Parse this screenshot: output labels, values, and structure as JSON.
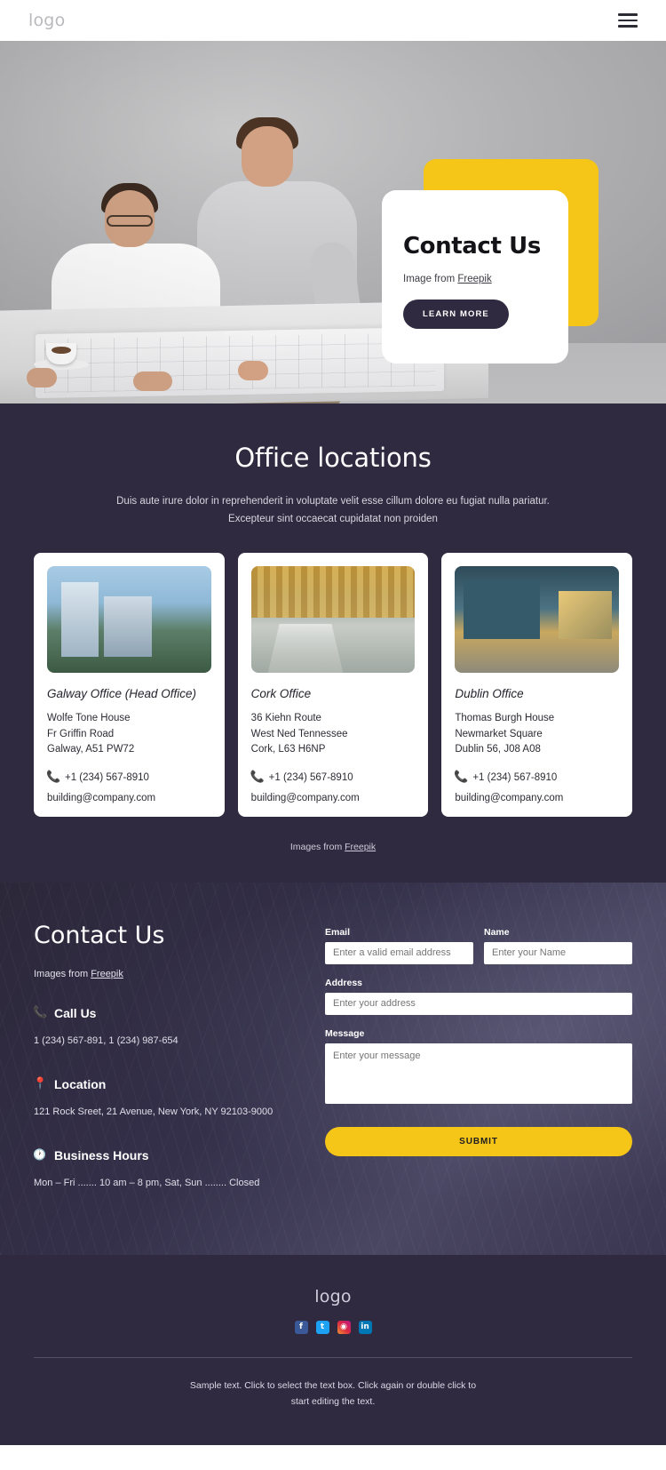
{
  "header": {
    "logo": "logo",
    "menu_icon": "hamburger-menu-icon"
  },
  "hero": {
    "title": "Contact Us",
    "credit_prefix": "Image from ",
    "credit_link": "Freepik",
    "button_label": "LEARN MORE",
    "accent_color": "#f5c518",
    "button_color": "#2f2a3f"
  },
  "offices": {
    "heading": "Office locations",
    "lead_line1": "Duis aute irure dolor in reprehenderit in voluptate velit esse cillum dolore eu fugiat nulla pariatur.",
    "lead_line2": "Excepteur sint occaecat cupidatat non proiden",
    "credit_prefix": "Images from ",
    "credit_link": "Freepik",
    "cards": [
      {
        "title": "Galway Office (Head Office)",
        "address_1": "Wolfe Tone House",
        "address_2": "Fr Griffin Road",
        "address_3": "Galway, A51 PW72",
        "phone": "+1 (234) 567-8910",
        "email": "building@company.com"
      },
      {
        "title": "Cork Office",
        "address_1": "36 Kiehn Route",
        "address_2": "West Ned Tennessee",
        "address_3": "Cork, L63 H6NP",
        "phone": "+1 (234) 567-8910",
        "email": "building@company.com"
      },
      {
        "title": "Dublin Office",
        "address_1": "Thomas Burgh House",
        "address_2": "Newmarket Square",
        "address_3": "Dublin 56, J08 A08",
        "phone": "+1 (234) 567-8910",
        "email": "building@company.com"
      }
    ]
  },
  "contact": {
    "heading": "Contact Us",
    "credit_prefix": "Images from ",
    "credit_link": "Freepik",
    "call_us": {
      "title": "Call Us",
      "value": "1 (234) 567-891, 1 (234) 987-654"
    },
    "location": {
      "title": "Location",
      "value": "121 Rock Sreet, 21 Avenue, New York, NY 92103-9000"
    },
    "business_hours": {
      "title": "Business Hours",
      "value": "Mon – Fri ....... 10 am – 8 pm, Sat, Sun ........ Closed"
    },
    "form": {
      "email_label": "Email",
      "email_placeholder": "Enter a valid email address",
      "email_value": "",
      "name_label": "Name",
      "name_placeholder": "Enter your Name",
      "name_value": "",
      "address_label": "Address",
      "address_placeholder": "Enter your address",
      "address_value": "",
      "message_label": "Message",
      "message_placeholder": "Enter your message",
      "message_value": "",
      "submit_label": "SUBMIT",
      "submit_color": "#f5c518"
    }
  },
  "footer": {
    "logo": "logo",
    "socials": [
      {
        "name": "facebook",
        "glyph": "f"
      },
      {
        "name": "twitter",
        "glyph": "t"
      },
      {
        "name": "instagram",
        "glyph": "◉"
      },
      {
        "name": "linkedin",
        "glyph": "in"
      }
    ],
    "note_line1": "Sample text. Click to select the text box. Click again or double click to",
    "note_line2": "start editing the text."
  }
}
